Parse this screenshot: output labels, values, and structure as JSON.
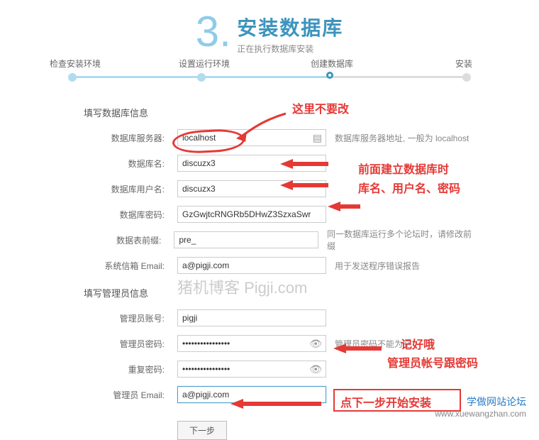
{
  "header": {
    "step_number": "3.",
    "title": "安装数据库",
    "subtitle": "正在执行数据库安装"
  },
  "progress": {
    "steps": [
      "检查安装环境",
      "设置运行环境",
      "创建数据库",
      "安装"
    ]
  },
  "sections": {
    "db_title": "填写数据库信息",
    "admin_title": "填写管理员信息"
  },
  "fields": {
    "db_server": {
      "label": "数据库服务器:",
      "value": "localhost",
      "hint": "数据库服务器地址, 一般为 localhost"
    },
    "db_name": {
      "label": "数据库名:",
      "value": "discuzx3",
      "hint": ""
    },
    "db_user": {
      "label": "数据库用户名:",
      "value": "discuzx3",
      "hint": ""
    },
    "db_pass": {
      "label": "数据库密码:",
      "value": "GzGwjtcRNGRb5DHwZ3SzxaSwr",
      "hint": ""
    },
    "db_prefix": {
      "label": "数据表前缀:",
      "value": "pre_",
      "hint": "同一数据库运行多个论坛时，请修改前缀"
    },
    "sys_email": {
      "label": "系统信箱 Email:",
      "value": "a@pigji.com",
      "hint": "用于发送程序错误报告"
    },
    "admin_user": {
      "label": "管理员账号:",
      "value": "pigji",
      "hint": ""
    },
    "admin_pass": {
      "label": "管理员密码:",
      "value": "••••••••••••••••",
      "hint": "管理员密码不能为空"
    },
    "admin_pass2": {
      "label": "重复密码:",
      "value": "••••••••••••••••",
      "hint": ""
    },
    "admin_email": {
      "label": "管理员 Email:",
      "value": "a@pigji.com",
      "hint": ""
    }
  },
  "button": {
    "next": "下一步"
  },
  "annotations": {
    "a1": "这里不要改",
    "a2_line1": "前面建立数据库时",
    "a2_line2": "库名、用户名、密码",
    "a3": "记好哦",
    "a3_line2": "管理员帐号跟密码",
    "a4": "点下一步开始安装"
  },
  "watermark": "猪机博客 Pigji.com",
  "footer": {
    "cn": "学做网站论坛",
    "url": "www.xuewangzhan.com"
  }
}
